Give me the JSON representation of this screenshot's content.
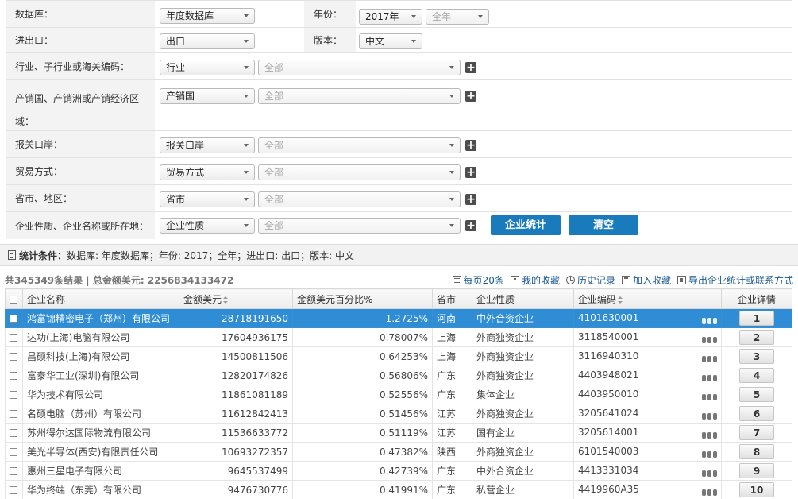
{
  "filters": {
    "database_label": "数据库：",
    "database_value": "年度数据库",
    "year_label": "年份：",
    "year_value": "2017年",
    "period_value": "全年",
    "trade_label": "进出口：",
    "trade_value": "出口",
    "version_label": "版本：",
    "version_value": "中文",
    "industry_label": "行业、子行业或海关编码：",
    "industry_type": "行业",
    "industry_value": "全部",
    "origin_label": "产销国、产销洲或产销经济区域：",
    "origin_type": "产销国",
    "origin_value": "全部",
    "port_label": "报关口岸：",
    "port_type": "报关口岸",
    "port_value": "全部",
    "trademode_label": "贸易方式：",
    "trademode_type": "贸易方式",
    "trademode_value": "全部",
    "region_label": "省市、地区：",
    "region_type": "省市",
    "region_value": "全部",
    "company_label": "企业性质、企业名称或所在地：",
    "company_type": "企业性质",
    "company_value": "全部",
    "plus": "+",
    "stat_button": "企业统计",
    "clear_button": "清空"
  },
  "stat_bar": {
    "title": "统计条件：",
    "conditions": "数据库: 年度数据库；年份: 2017；全年；进出口: 出口；版本: 中文"
  },
  "summary": "共345349条结果 | 总金额美元: 2256834133472",
  "toolbar": {
    "per_page": "每页20条",
    "my_favorites": "我的收藏",
    "history": "历史记录",
    "add_favorite": "加入收藏",
    "export": "导出企业统计或联系方式"
  },
  "table": {
    "columns": [
      "企业名称",
      "金额美元",
      "金额美元百分比%",
      "省市",
      "企业性质",
      "企业编码",
      "企业详情"
    ],
    "rows": [
      {
        "name": "鸿富锦精密电子（郑州）有限公司",
        "amount": "28718191650",
        "pct": "1.2725%",
        "province": "河南",
        "type": "中外合资企业",
        "code": "4101630001",
        "detail": "1"
      },
      {
        "name": "达功(上海)电脑有限公司",
        "amount": "17604936175",
        "pct": "0.78007%",
        "province": "上海",
        "type": "外商独资企业",
        "code": "3118540001",
        "detail": "2"
      },
      {
        "name": "昌硕科技(上海)有限公司",
        "amount": "14500811506",
        "pct": "0.64253%",
        "province": "上海",
        "type": "外商独资企业",
        "code": "3116940310",
        "detail": "3"
      },
      {
        "name": "富泰华工业(深圳)有限公司",
        "amount": "12820174826",
        "pct": "0.56806%",
        "province": "广东",
        "type": "外商独资企业",
        "code": "4403948021",
        "detail": "4"
      },
      {
        "name": "华为技术有限公司",
        "amount": "11861081189",
        "pct": "0.52556%",
        "province": "广东",
        "type": "集体企业",
        "code": "4403950010",
        "detail": "5"
      },
      {
        "name": "名硕电脑（苏州）有限公司",
        "amount": "11612842413",
        "pct": "0.51456%",
        "province": "江苏",
        "type": "外商独资企业",
        "code": "3205641024",
        "detail": "6"
      },
      {
        "name": "苏州得尔达国际物流有限公司",
        "amount": "11536633772",
        "pct": "0.51119%",
        "province": "江苏",
        "type": "国有企业",
        "code": "3205614001",
        "detail": "7"
      },
      {
        "name": "美光半导体(西安)有限责任公司",
        "amount": "10693272357",
        "pct": "0.47382%",
        "province": "陕西",
        "type": "外商独资企业",
        "code": "6101540003",
        "detail": "8"
      },
      {
        "name": "惠州三星电子有限公司",
        "amount": "9645537499",
        "pct": "0.42739%",
        "province": "广东",
        "type": "中外合资企业",
        "code": "4413331034",
        "detail": "9"
      },
      {
        "name": "华为终端（东莞）有限公司",
        "amount": "9476730776",
        "pct": "0.41991%",
        "province": "广东",
        "type": "私营企业",
        "code": "4419960A35",
        "detail": "10"
      }
    ]
  }
}
